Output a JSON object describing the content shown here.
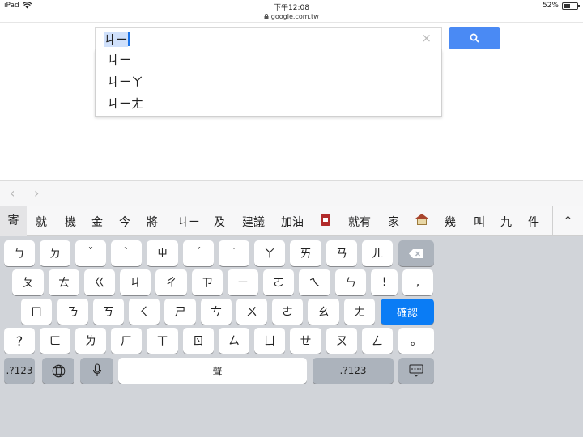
{
  "status_bar": {
    "device": "iPad",
    "time": "下午12:08",
    "url": "google.com.tw",
    "battery": "52%",
    "battery_level": 0.52
  },
  "search": {
    "query_highlight": "ㄐㄧ",
    "clear_glyph": "×"
  },
  "suggestions": [
    "ㄐㄧ",
    "ㄐㄧㄚ",
    "ㄐㄧㄤ"
  ],
  "keyboard": {
    "nav": {
      "back": "‹",
      "forward": "›"
    },
    "candidates": [
      "寄",
      "就",
      "機",
      "金",
      "今",
      "將",
      "ㄐㄧ",
      "及",
      "建議",
      "加油",
      "",
      "就有",
      "家",
      "",
      "幾",
      "叫",
      "九",
      "件"
    ],
    "expand": "^",
    "row1": [
      "ㄅ",
      "ㄉ",
      "ˇ",
      "ˋ",
      "ㄓ",
      "ˊ",
      "˙",
      "ㄚ",
      "ㄞ",
      "ㄢ",
      "ㄦ"
    ],
    "row2": [
      "ㄆ",
      "ㄊ",
      "ㄍ",
      "ㄐ",
      "ㄔ",
      "ㄗ",
      "ㄧ",
      "ㄛ",
      "ㄟ",
      "ㄣ",
      "!",
      ","
    ],
    "row3": [
      "ㄇ",
      "ㄋ",
      "ㄎ",
      "ㄑ",
      "ㄕ",
      "ㄘ",
      "ㄨ",
      "ㄜ",
      "ㄠ",
      "ㄤ"
    ],
    "confirm": "確認",
    "row4": [
      "?",
      "ㄈ",
      "ㄌ",
      "ㄏ",
      "ㄒ",
      "ㄖ",
      "ㄙ",
      "ㄩ",
      "ㄝ",
      "ㄡ",
      "ㄥ",
      "。"
    ],
    "numbers": ".?123",
    "space": "一聲",
    "numbers_right": ".?123"
  }
}
